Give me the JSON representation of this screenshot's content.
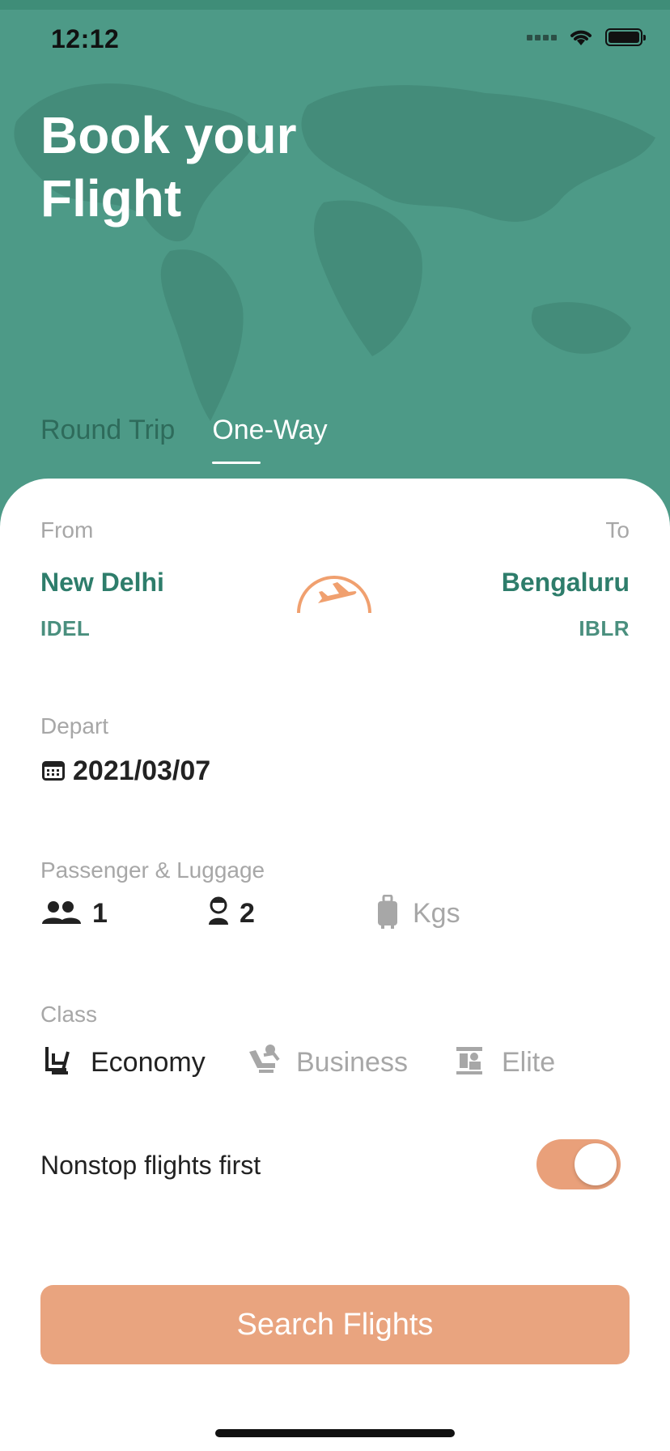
{
  "status_bar": {
    "time": "12:12"
  },
  "header": {
    "title_line1": "Book your",
    "title_line2": "Flight",
    "tabs": [
      {
        "label": "Round Trip",
        "active": false
      },
      {
        "label": "One-Way",
        "active": true
      }
    ]
  },
  "route": {
    "from_label": "From",
    "to_label": "To",
    "from_city": "New Delhi",
    "from_code": "IDEL",
    "to_city": "Bengaluru",
    "to_code": "IBLR",
    "icon": "plane-takeoff-icon"
  },
  "depart": {
    "label": "Depart",
    "date": "2021/03/07",
    "icon": "calendar-icon"
  },
  "passengers": {
    "label": "Passenger & Luggage",
    "adults": "1",
    "children": "2",
    "luggage_unit": "Kgs"
  },
  "class": {
    "label": "Class",
    "options": [
      {
        "label": "Economy",
        "selected": true
      },
      {
        "label": "Business",
        "selected": false
      },
      {
        "label": "Elite",
        "selected": false
      }
    ]
  },
  "nonstop": {
    "label": "Nonstop flights first",
    "enabled": true
  },
  "search_button": {
    "label": "Search Flights"
  },
  "colors": {
    "header_bg": "#4d9a87",
    "accent_orange": "#e9a47f",
    "primary_green": "#2e7d6b"
  }
}
